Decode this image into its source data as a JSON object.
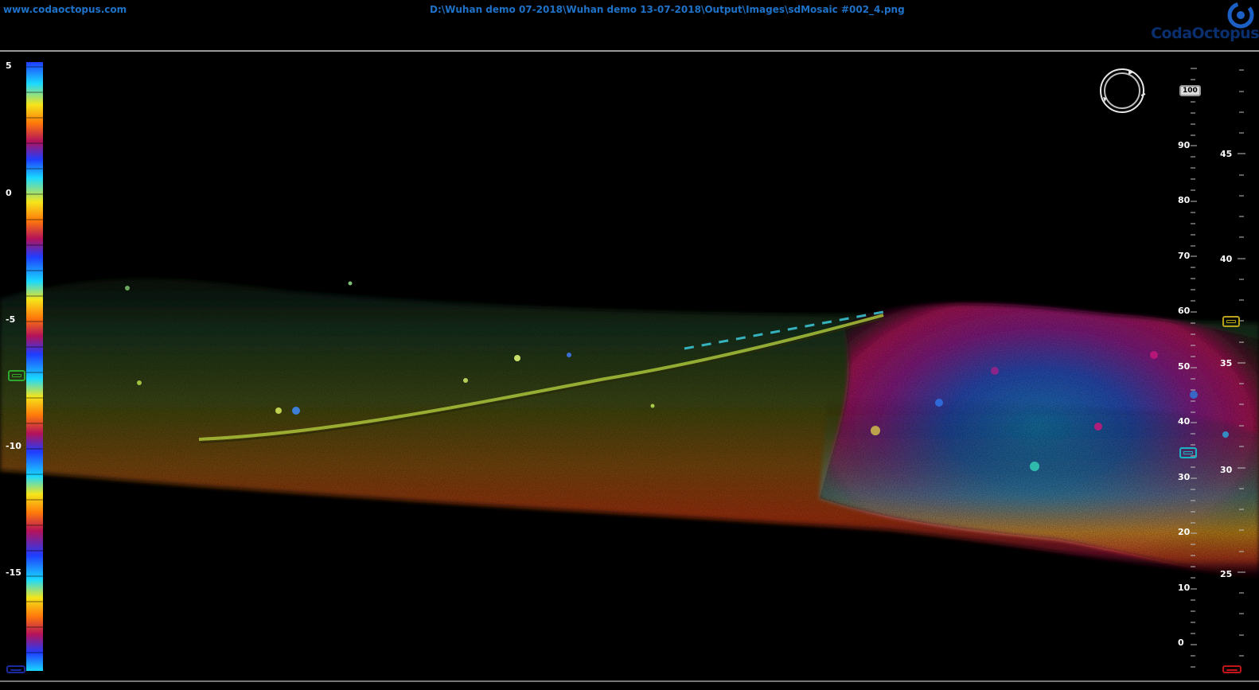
{
  "header": {
    "site_link": "www.codaoctopus.com",
    "file_path": "D:\\Wuhan demo 07-2018\\Wuhan demo 13-07-2018\\Output\\Images\\sdMosaic #002_4.png",
    "logo_text": "CodaOctopus"
  },
  "color_scale": {
    "tick_labels": [
      "5",
      "0",
      "-5",
      "-10",
      "-15"
    ],
    "palette": [
      "#1f3cff",
      "#19d9ff",
      "#f5e51a",
      "#ff7a0a",
      "#b4125a",
      "#7a22d9"
    ]
  },
  "left_scale": {
    "labels": [
      "100",
      "90",
      "80",
      "70",
      "60",
      "50",
      "40",
      "30",
      "20",
      "10",
      "0"
    ],
    "marker_value": "100"
  },
  "right_scale": {
    "labels": [
      "45",
      "40",
      "35",
      "30",
      "25"
    ]
  },
  "markers": {
    "left_colorbar": "#2ea82e",
    "right_upper": "#b7a11a",
    "left_scale_lower": "#19b3c4",
    "right_bottom": "#c0161a",
    "left_bottom": "#1a2a9e"
  },
  "compass_icon": "rotate-compass-icon"
}
